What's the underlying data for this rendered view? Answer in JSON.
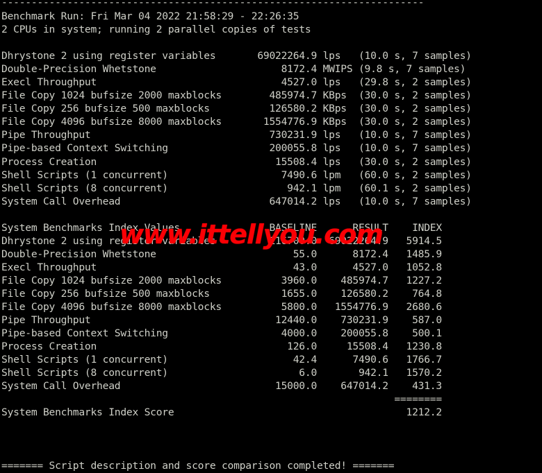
{
  "terminal": {
    "background_color": "#000000",
    "text_color": "#cfd0c8",
    "top_rule": "-----------------------------------------------------------------------",
    "header": {
      "run_line": "Benchmark Run: Fri Mar 04 2022 21:58:29 - 22:26:35",
      "cpu_line": "2 CPUs in system; running 2 parallel copies of tests"
    },
    "raw_results": [
      {
        "name": "Dhrystone 2 using register variables",
        "value": "69022264.9",
        "unit": "lps",
        "timing": "(10.0 s, 7 samples)"
      },
      {
        "name": "Double-Precision Whetstone",
        "value": "8172.4",
        "unit": "MWIPS",
        "timing": "(9.8 s, 7 samples)"
      },
      {
        "name": "Execl Throughput",
        "value": "4527.0",
        "unit": "lps",
        "timing": "(29.8 s, 2 samples)"
      },
      {
        "name": "File Copy 1024 bufsize 2000 maxblocks",
        "value": "485974.7",
        "unit": "KBps",
        "timing": "(30.0 s, 2 samples)"
      },
      {
        "name": "File Copy 256 bufsize 500 maxblocks",
        "value": "126580.2",
        "unit": "KBps",
        "timing": "(30.0 s, 2 samples)"
      },
      {
        "name": "File Copy 4096 bufsize 8000 maxblocks",
        "value": "1554776.9",
        "unit": "KBps",
        "timing": "(30.0 s, 2 samples)"
      },
      {
        "name": "Pipe Throughput",
        "value": "730231.9",
        "unit": "lps",
        "timing": "(10.0 s, 7 samples)"
      },
      {
        "name": "Pipe-based Context Switching",
        "value": "200055.8",
        "unit": "lps",
        "timing": "(10.0 s, 7 samples)"
      },
      {
        "name": "Process Creation",
        "value": "15508.4",
        "unit": "lps",
        "timing": "(30.0 s, 2 samples)"
      },
      {
        "name": "Shell Scripts (1 concurrent)",
        "value": "7490.6",
        "unit": "lpm",
        "timing": "(60.0 s, 2 samples)"
      },
      {
        "name": "Shell Scripts (8 concurrent)",
        "value": "942.1",
        "unit": "lpm",
        "timing": "(60.1 s, 2 samples)"
      },
      {
        "name": "System Call Overhead",
        "value": "647014.2",
        "unit": "lps",
        "timing": "(10.0 s, 7 samples)"
      }
    ],
    "index_table": {
      "title": "System Benchmarks Index Values",
      "columns": [
        "BASELINE",
        "RESULT",
        "INDEX"
      ],
      "rows": [
        {
          "name": "Dhrystone 2 using register variables",
          "baseline": "116700.0",
          "result": "69022264.9",
          "index": "5914.5"
        },
        {
          "name": "Double-Precision Whetstone",
          "baseline": "55.0",
          "result": "8172.4",
          "index": "1485.9"
        },
        {
          "name": "Execl Throughput",
          "baseline": "43.0",
          "result": "4527.0",
          "index": "1052.8"
        },
        {
          "name": "File Copy 1024 bufsize 2000 maxblocks",
          "baseline": "3960.0",
          "result": "485974.7",
          "index": "1227.2"
        },
        {
          "name": "File Copy 256 bufsize 500 maxblocks",
          "baseline": "1655.0",
          "result": "126580.2",
          "index": "764.8"
        },
        {
          "name": "File Copy 4096 bufsize 8000 maxblocks",
          "baseline": "5800.0",
          "result": "1554776.9",
          "index": "2680.6"
        },
        {
          "name": "Pipe Throughput",
          "baseline": "12440.0",
          "result": "730231.9",
          "index": "587.0"
        },
        {
          "name": "Pipe-based Context Switching",
          "baseline": "4000.0",
          "result": "200055.8",
          "index": "500.1"
        },
        {
          "name": "Process Creation",
          "baseline": "126.0",
          "result": "15508.4",
          "index": "1230.8"
        },
        {
          "name": "Shell Scripts (1 concurrent)",
          "baseline": "42.4",
          "result": "7490.6",
          "index": "1766.7"
        },
        {
          "name": "Shell Scripts (8 concurrent)",
          "baseline": "6.0",
          "result": "942.1",
          "index": "1570.2"
        },
        {
          "name": "System Call Overhead",
          "baseline": "15000.0",
          "result": "647014.2",
          "index": "431.3"
        }
      ],
      "separator": "========",
      "score_label": "System Benchmarks Index Score",
      "score_value": "1212.2"
    },
    "footer": "======= Script description and score comparison completed! ======="
  },
  "watermark": {
    "text": "www.ittellyou.com",
    "color": "#fb0005"
  }
}
